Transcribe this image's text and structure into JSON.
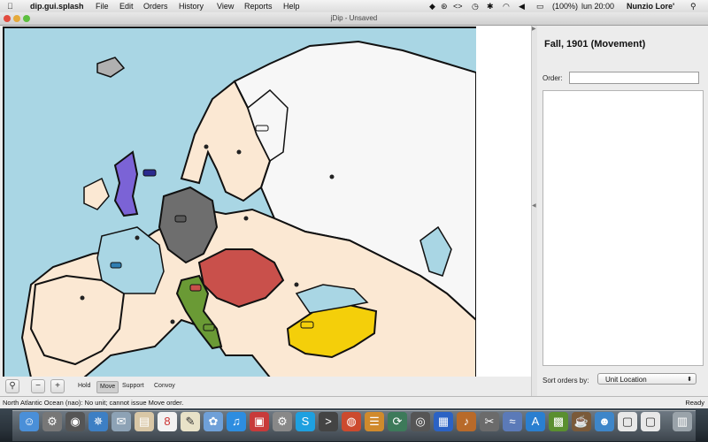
{
  "menubar": {
    "apple": "",
    "app_name": "dip.gui.splash",
    "items": [
      "File",
      "Edit",
      "Orders",
      "History",
      "View",
      "Reports",
      "Help"
    ],
    "battery": "(100%)",
    "clock": "lun 20:00",
    "user": "Nunzio Lore'"
  },
  "window": {
    "title": "jDip - Unsaved"
  },
  "map": {
    "sea_color": "#a9d6e4",
    "neutral_color": "#fbe8d3",
    "russia_color": "#f7f7f7",
    "england_color": "#7b63d6",
    "germany_color": "#6e6e6e",
    "austria_color": "#c9504b",
    "italy_color": "#6a9a35",
    "turkey_color": "#f4cf0a",
    "unit_labels": [
      "🚢",
      "■"
    ]
  },
  "toolbar": {
    "modes": [
      "Hold",
      "Move",
      "Support",
      "Convoy"
    ],
    "active_mode": "Move"
  },
  "panel": {
    "phase": "Fall, 1901 (Movement)",
    "order_label": "Order:",
    "order_value": "",
    "sort_label": "Sort orders by:",
    "sort_value": "Unit Location"
  },
  "status": {
    "message": "North Atlantic Ocean (nao): No unit; cannot issue Move order.",
    "state": "Ready"
  }
}
